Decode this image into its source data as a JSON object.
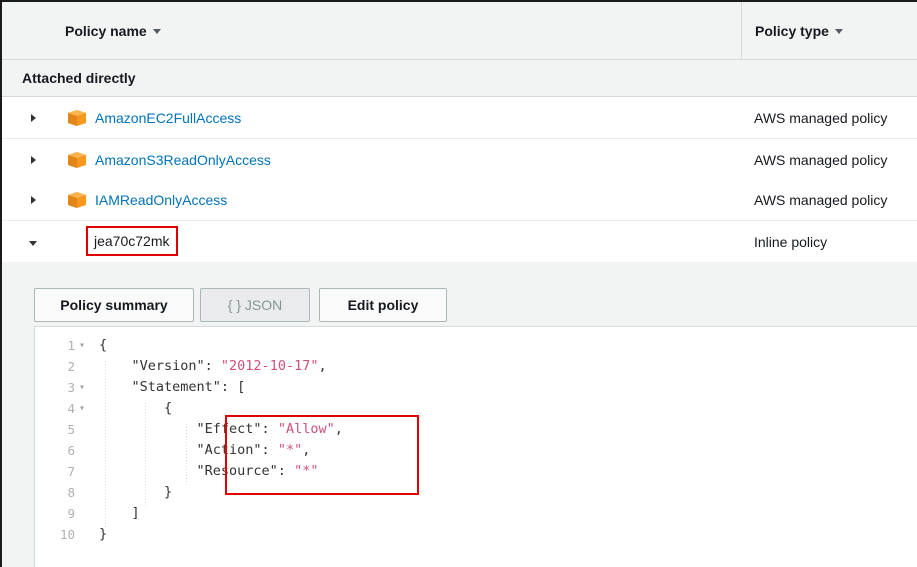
{
  "table": {
    "columns": [
      {
        "label": "Policy name"
      },
      {
        "label": "Policy type"
      }
    ],
    "section_label": "Attached directly",
    "rows": [
      {
        "name": "AmazonEC2FullAccess",
        "type": "AWS managed policy",
        "icon": "aws-box-icon"
      },
      {
        "name": "AmazonS3ReadOnlyAccess",
        "type": "AWS managed policy",
        "icon": "aws-box-icon"
      },
      {
        "name": "IAMReadOnlyAccess",
        "type": "AWS managed policy",
        "icon": "aws-box-icon"
      },
      {
        "name": "jea70c72mk",
        "type": "Inline policy"
      }
    ]
  },
  "detail": {
    "buttons": {
      "summary": "Policy summary",
      "json": "{ } JSON",
      "edit": "Edit policy"
    },
    "editor": {
      "line_numbers": [
        "1",
        "2",
        "3",
        "4",
        "5",
        "6",
        "7",
        "8",
        "9",
        "10"
      ],
      "lines": [
        [
          "{",
          ""
        ],
        [
          "    \"Version\": ",
          "\"2012-10-17\"",
          ","
        ],
        [
          "    \"Statement\": [",
          ""
        ],
        [
          "        {",
          ""
        ],
        [
          "            \"Effect\": ",
          "\"Allow\"",
          ","
        ],
        [
          "            \"Action\": ",
          "\"*\"",
          ","
        ],
        [
          "            \"Resource\": ",
          "\"*\"",
          ""
        ],
        [
          "        }",
          ""
        ],
        [
          "    ]",
          ""
        ],
        [
          "}",
          ""
        ]
      ]
    }
  },
  "colors": {
    "link": "#0073bb",
    "highlight_border": "#e00000",
    "string": "#d14f7a",
    "aws_orange": "#f7981d"
  }
}
